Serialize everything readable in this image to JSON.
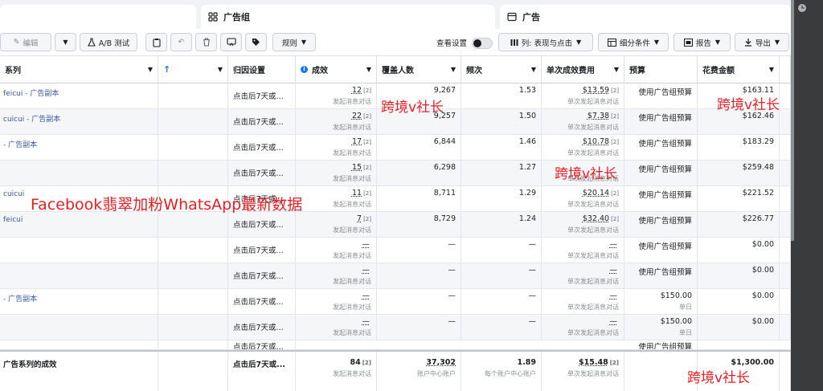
{
  "tabs": [
    {
      "label": ""
    },
    {
      "label": "广告组"
    },
    {
      "label": "广告"
    }
  ],
  "toolbar": {
    "edit_label": "编辑",
    "ab_test_label": "A/B 测试",
    "rules_label": "规则",
    "view_settings_label": "查看设置",
    "columns_label": "列: 表现与点击",
    "breakdown_label": "细分条件",
    "reports_label": "报告",
    "export_label": "导出"
  },
  "table": {
    "headers": {
      "name": "系列",
      "attribution": "归因设置",
      "results": "成效",
      "reach": "覆盖人数",
      "frequency": "频次",
      "cost_per_result": "单次成效费用",
      "budget": "预算",
      "amount_spent": "花费金额"
    },
    "rows": [
      {
        "name": "feicui - 广告副本",
        "attribution": "点击后7天或...",
        "results": "12",
        "results_note": "[2]",
        "results_sub": "发起消息对话",
        "reach": "9,267",
        "frequency": "1.53",
        "cost": "$13.59",
        "cost_note": "[2]",
        "cost_sub": "单次发起消息对话",
        "budget": "使用广告组预算",
        "budget_sub": "",
        "spent": "$163.11"
      },
      {
        "name": "cuicui - 广告副本",
        "attribution": "点击后7天或...",
        "results": "22",
        "results_note": "[2]",
        "results_sub": "发起消息对话",
        "reach": "9,257",
        "frequency": "1.50",
        "cost": "$7.38",
        "cost_note": "[2]",
        "cost_sub": "单次发起消息对话",
        "budget": "使用广告组预算",
        "budget_sub": "",
        "spent": "$162.46"
      },
      {
        "name": "- 广告副本",
        "attribution": "点击后7天或...",
        "results": "17",
        "results_note": "[2]",
        "results_sub": "发起消息对话",
        "reach": "6,844",
        "frequency": "1.46",
        "cost": "$10.78",
        "cost_note": "[2]",
        "cost_sub": "单次发起消息对话",
        "budget": "使用广告组预算",
        "budget_sub": "",
        "spent": "$183.29"
      },
      {
        "name": "",
        "attribution": "点击后7天或...",
        "results": "15",
        "results_note": "[2]",
        "results_sub": "发起消息对话",
        "reach": "6,298",
        "frequency": "1.27",
        "cost": "",
        "cost_note": "",
        "cost_sub": "单次发起消息对话",
        "budget": "使用广告组预算",
        "budget_sub": "",
        "spent": "$259.48"
      },
      {
        "name": "cuicui",
        "attribution": "点击后7天或...",
        "results": "11",
        "results_note": "[2]",
        "results_sub": "发起消息对话",
        "reach": "8,711",
        "frequency": "1.29",
        "cost": "$20.14",
        "cost_note": "[2]",
        "cost_sub": "单次发起消息对话",
        "budget": "使用广告组预算",
        "budget_sub": "",
        "spent": "$221.52"
      },
      {
        "name": "feicui",
        "attribution": "点击后7天或...",
        "results": "7",
        "results_note": "[2]",
        "results_sub": "发起消息对话",
        "reach": "8,729",
        "frequency": "1.24",
        "cost": "$32.40",
        "cost_note": "[2]",
        "cost_sub": "单次发起消息对话",
        "budget": "使用广告组预算",
        "budget_sub": "",
        "spent": "$226.77"
      },
      {
        "name": "",
        "attribution": "点击后7天或...",
        "results": "—",
        "results_note": "",
        "results_sub": "发起消息对话",
        "reach": "—",
        "frequency": "—",
        "cost": "—",
        "cost_note": "",
        "cost_sub": "单次发起消息对话",
        "budget": "使用广告组预算",
        "budget_sub": "",
        "spent": "$0.00"
      },
      {
        "name": "",
        "attribution": "点击后7天或...",
        "results": "—",
        "results_note": "",
        "results_sub": "发起消息对话",
        "reach": "—",
        "frequency": "—",
        "cost": "—",
        "cost_note": "",
        "cost_sub": "单次发起消息对话",
        "budget": "使用广告组预算",
        "budget_sub": "",
        "spent": "$0.00"
      },
      {
        "name": "- 广告副本",
        "attribution": "点击后7天或...",
        "results": "—",
        "results_note": "",
        "results_sub": "发起消息对话",
        "reach": "—",
        "frequency": "—",
        "cost": "—",
        "cost_note": "",
        "cost_sub": "单次发起消息对话",
        "budget": "$150.00",
        "budget_sub": "单日",
        "spent": "$0.00"
      },
      {
        "name": "",
        "attribution": "点击后7天或...",
        "results": "—",
        "results_note": "",
        "results_sub": "发起消息对话",
        "reach": "—",
        "frequency": "—",
        "cost": "—",
        "cost_note": "",
        "cost_sub": "单次发起消息对话",
        "budget": "$150.00",
        "budget_sub": "单日",
        "spent": "$0.00"
      }
    ],
    "partial_row": {
      "attribution": "点击后7天或...",
      "budget": "使用广告组预算"
    },
    "summary": {
      "name": "广告系列的成效",
      "attribution": "点击后7天或...",
      "results": "84",
      "results_note": "[2]",
      "results_sub": "发起消息对话",
      "reach": "37,302",
      "reach_sub": "账户中心账户",
      "frequency": "1.89",
      "frequency_sub": "每个账户中心账户",
      "cost": "$15.48",
      "cost_note": "[2]",
      "cost_sub": "单次发起消息对话",
      "spent": "$1,300.00"
    }
  },
  "watermarks": {
    "w1": "跨境v社长",
    "w2": "跨境v社长",
    "w3": "跨境v社长",
    "w4": "Facebook翡翠加粉WhatsApp最新数据",
    "w5": "跨境v社长"
  },
  "colors": {
    "link": "#385898",
    "watermark": "#e41e26",
    "info_icon": "#1877f2"
  }
}
